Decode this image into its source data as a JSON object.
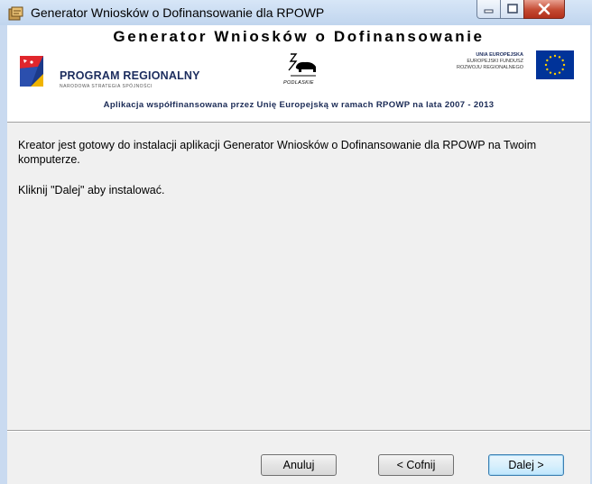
{
  "window": {
    "title": "Generator Wniosków o Dofinansowanie dla RPOWP"
  },
  "banner": {
    "title": "Generator Wniosków o Dofinansowanie",
    "program_name": "PROGRAM REGIONALNY",
    "program_subtitle": "NARODOWA STRATEGIA SPÓJNOŚCI",
    "region_name": "PODLASKIE",
    "eu_line1": "UNIA EUROPEJSKA",
    "eu_line2": "EUROPEJSKI FUNDUSZ",
    "eu_line3": "ROZWOJU REGIONALNEGO",
    "cofinance_text": "Aplikacja współfinansowana przez Unię Europejską w ramach RPOWP na lata 2007 - 2013"
  },
  "content": {
    "message1": "Kreator jest gotowy do instalacji aplikacji Generator Wniosków o Dofinansowanie dla RPOWP na Twoim komputerze.",
    "message2": "Kliknij \"Dalej\" aby instalować."
  },
  "buttons": {
    "cancel": "Anuluj",
    "back": "< Cofnij",
    "next": "Dalej >"
  },
  "colors": {
    "eu_blue": "#003399",
    "eu_star": "#ffcc00",
    "banner_text": "#1a2a55"
  }
}
